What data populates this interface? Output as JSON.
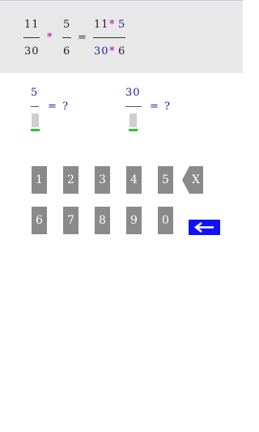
{
  "expression": {
    "left_fraction": {
      "numerator": "11",
      "denominator": "30"
    },
    "operator": "*",
    "right_fraction": {
      "numerator": "5",
      "denominator": "6"
    },
    "equals": "=",
    "result_fraction": {
      "numerator": {
        "a": "11",
        "op": "*",
        "b": "5"
      },
      "denominator": {
        "a": "30",
        "op": "*",
        "b": "6"
      }
    }
  },
  "questions": [
    {
      "numerator": "5",
      "equals": "=",
      "answer": "?"
    },
    {
      "numerator": "30",
      "equals": "=",
      "answer": "?"
    }
  ],
  "keypad": {
    "row1": [
      "1",
      "2",
      "3",
      "4",
      "5"
    ],
    "row2": [
      "6",
      "7",
      "8",
      "9",
      "0"
    ],
    "backspace_label": "X",
    "enter_icon": "left-arrow-icon"
  },
  "colors": {
    "panel_bg": "#e8e8e8",
    "key_bg": "#8a8a8a",
    "enter_bg": "#1010ff",
    "number_blue": "#1a1aa8",
    "operator_magenta": "#b000b0",
    "cursor_green": "#22cc22"
  }
}
